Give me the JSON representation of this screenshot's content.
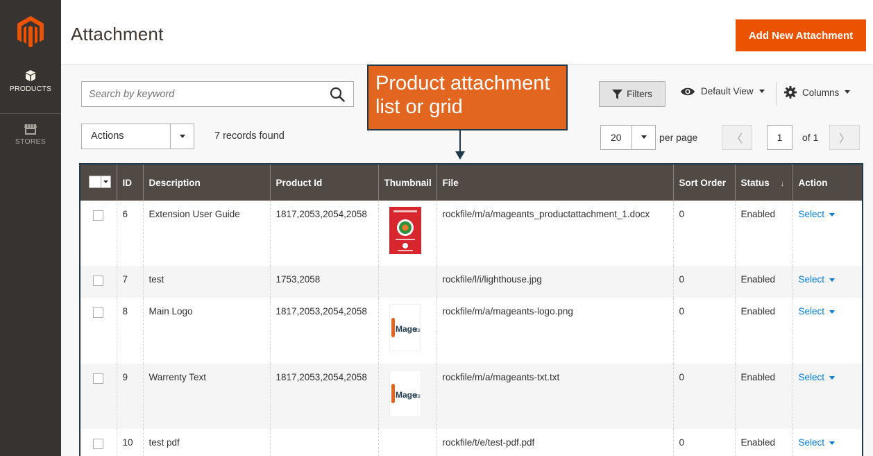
{
  "sidebar": {
    "items": [
      {
        "label": "PRODUCTS",
        "icon": "cube-icon"
      },
      {
        "label": "STORES",
        "icon": "store-icon"
      }
    ]
  },
  "header": {
    "title": "Attachment",
    "add_button": "Add New Attachment"
  },
  "search": {
    "placeholder": "Search by keyword"
  },
  "callout": {
    "line1": "Product attachment",
    "line2": "list or grid"
  },
  "toolbar": {
    "filters": "Filters",
    "default_view": "Default View",
    "columns": "Columns"
  },
  "actions": {
    "label": "Actions",
    "records_found": "7 records found"
  },
  "pagination": {
    "per_page_value": "20",
    "per_page_label": "per page",
    "current_page": "1",
    "of_label": "of 1",
    "prev": "〈",
    "next": "〉"
  },
  "grid": {
    "columns": [
      "ID",
      "Description",
      "Product Id",
      "Thumbnail",
      "File",
      "Sort Order",
      "Status",
      "Action"
    ],
    "sort_indicator": "↓",
    "rows": [
      {
        "id": "6",
        "description": "Extension User Guide",
        "product_id": "1817,2053,2054,2058",
        "thumbnail": "guide",
        "file": "rockfile/m/a/mageants_productattachment_1.docx",
        "sort_order": "0",
        "status": "Enabled",
        "action": "Select"
      },
      {
        "id": "7",
        "description": "test",
        "product_id": "1753,2058",
        "thumbnail": "",
        "file": "rockfile/l/i/lighthouse.jpg",
        "sort_order": "0",
        "status": "Enabled",
        "action": "Select"
      },
      {
        "id": "8",
        "description": "Main Logo",
        "product_id": "1817,2053,2054,2058",
        "thumbnail": "logo",
        "file": "rockfile/m/a/mageants-logo.png",
        "sort_order": "0",
        "status": "Enabled",
        "action": "Select"
      },
      {
        "id": "9",
        "description": "Warrenty Text",
        "product_id": "1817,2053,2054,2058",
        "thumbnail": "logo",
        "file": "rockfile/m/a/mageants-txt.txt",
        "sort_order": "0",
        "status": "Enabled",
        "action": "Select"
      },
      {
        "id": "10",
        "description": "test pdf",
        "product_id": "",
        "thumbnail": "",
        "file": "rockfile/t/e/test-pdf.pdf",
        "sort_order": "0",
        "status": "Enabled",
        "action": "Select"
      }
    ]
  },
  "colors": {
    "accent": "#eb5202",
    "sidebar": "#373330",
    "table_header": "#514943",
    "link": "#007bdb",
    "callout": "#e2661f",
    "callout_border": "#1e3a4c"
  }
}
